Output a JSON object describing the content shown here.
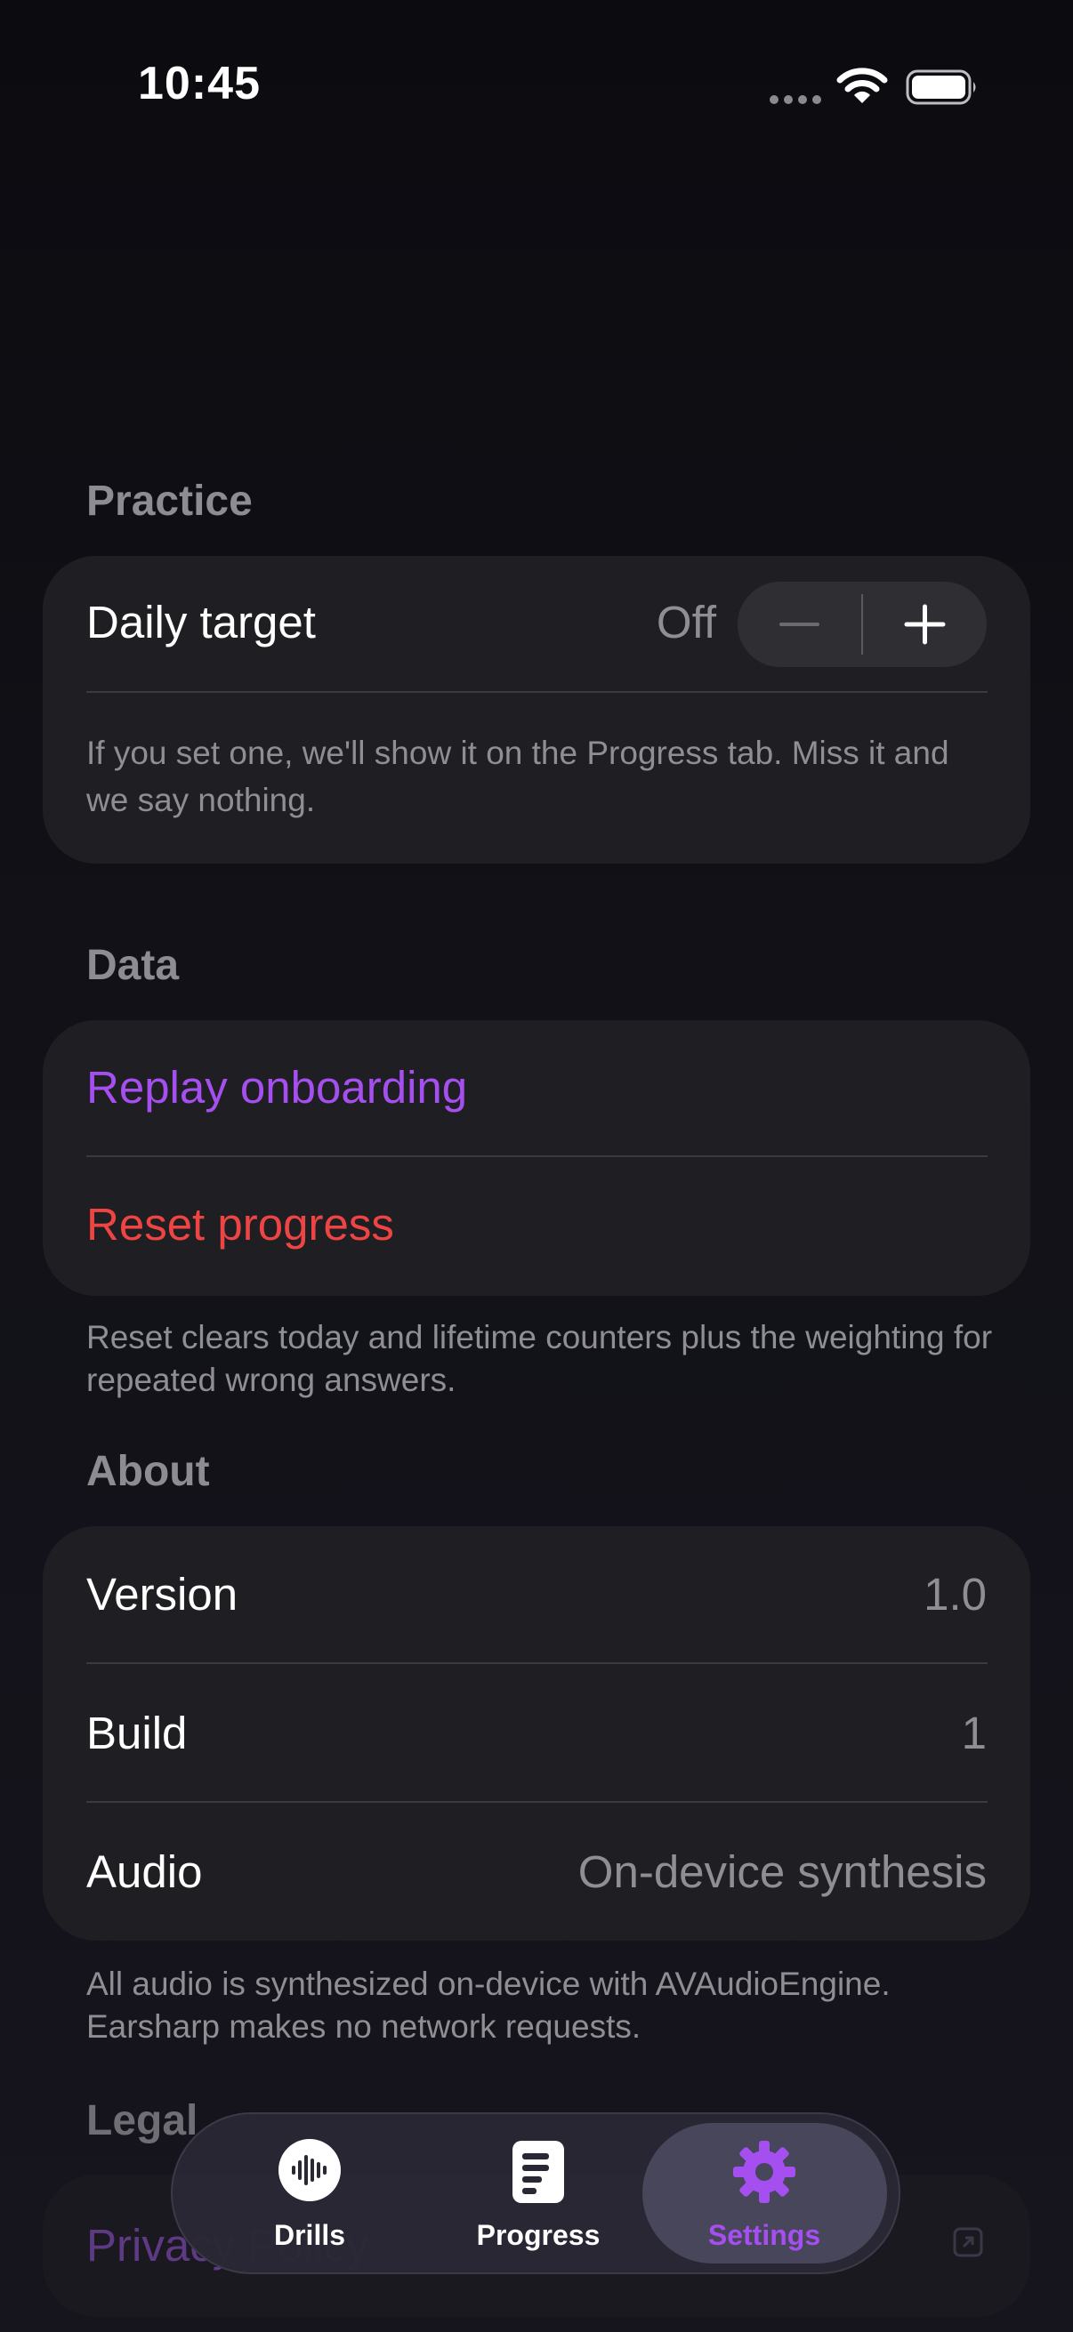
{
  "status_bar": {
    "time": "10:45"
  },
  "practice": {
    "header": "Practice",
    "daily_target_label": "Daily target",
    "daily_target_value": "Off",
    "stepper_minus": "−",
    "stepper_plus": "+",
    "note": "If you set one, we'll show it on the Progress tab. Miss it and we say nothing."
  },
  "data_section": {
    "header": "Data",
    "replay_onboarding": "Replay onboarding",
    "reset_progress": "Reset progress",
    "note": "Reset clears today and lifetime counters plus the weighting for repeated wrong answers."
  },
  "about": {
    "header": "About",
    "rows": [
      {
        "label": "Version",
        "value": "1.0"
      },
      {
        "label": "Build",
        "value": "1"
      },
      {
        "label": "Audio",
        "value": "On-device synthesis"
      }
    ],
    "note": "All audio is synthesized on-device with AVAudioEngine. Earsharp makes no network requests."
  },
  "legal": {
    "header": "Legal",
    "privacy_partial": "Privacy Policy"
  },
  "tab_bar": {
    "tabs": [
      {
        "label": "Drills",
        "icon": "waveform-icon"
      },
      {
        "label": "Progress",
        "icon": "chart-doc-icon"
      },
      {
        "label": "Settings",
        "icon": "gear-icon"
      }
    ],
    "active": "Settings"
  },
  "colors": {
    "accent": "#a64ff0",
    "destructive": "#ef4444",
    "card": "#1f1f23"
  }
}
